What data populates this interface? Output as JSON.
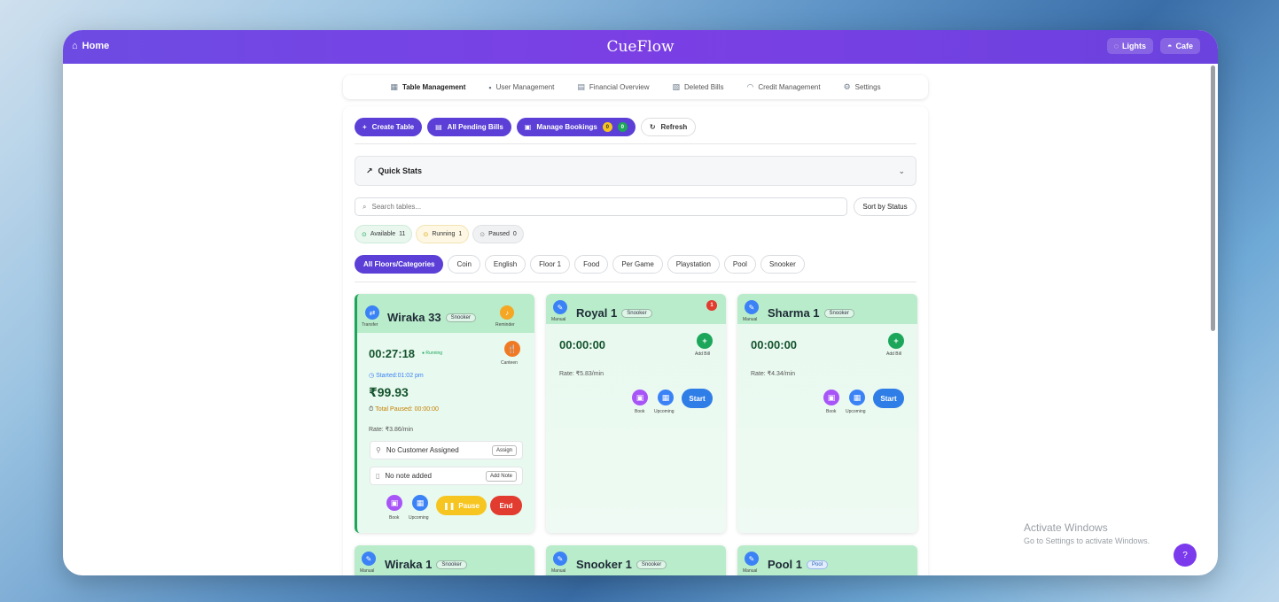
{
  "topbar": {
    "home_label": "Home",
    "brand": "CueFlow",
    "lights_label": "Lights",
    "cafe_label": "Cafe"
  },
  "tabs": [
    {
      "label": "Table Management",
      "icon": "table-icon"
    },
    {
      "label": "User Management",
      "icon": "users-icon"
    },
    {
      "label": "Financial Overview",
      "icon": "chart-icon"
    },
    {
      "label": "Deleted Bills",
      "icon": "bill-icon"
    },
    {
      "label": "Credit Management",
      "icon": "gauge-icon"
    },
    {
      "label": "Settings",
      "icon": "gear-icon"
    }
  ],
  "actions": {
    "create_table": "Create Table",
    "pending_bills": "All Pending Bills",
    "manage_bookings": "Manage Bookings",
    "bookings_badge_1": "0",
    "bookings_badge_2": "0",
    "refresh": "Refresh"
  },
  "quick_stats": {
    "label": "Quick Stats"
  },
  "search": {
    "placeholder": "Search tables...",
    "sort_label": "Sort by Status"
  },
  "status_filters": [
    {
      "label": "Available",
      "count": "11"
    },
    {
      "label": "Running",
      "count": "1"
    },
    {
      "label": "Paused",
      "count": "0"
    }
  ],
  "categories": [
    "All Floors/Categories",
    "Coin",
    "English",
    "Floor 1",
    "Food",
    "Per Game",
    "Playstation",
    "Pool",
    "Snooker"
  ],
  "cards": {
    "running": {
      "name": "Wiraka 33",
      "category": "Snooker",
      "transfer_label": "Transfer",
      "reminder_label": "Reminder",
      "timer": "00:27:18",
      "state": "Running",
      "canteen_label": "Canteen",
      "started": "Started:01:02 pm",
      "amount": "₹99.93",
      "paused": "Total Paused: 00:00:00",
      "rate": "Rate: ₹3.86/min",
      "customer": "No Customer Assigned",
      "assign": "Assign",
      "note": "No note added",
      "add_note": "Add Note",
      "book": "Book",
      "upcoming": "Upcoming",
      "pause": "Pause",
      "end": "End"
    },
    "royal": {
      "name": "Royal 1",
      "category": "Snooker",
      "mode": "Manual",
      "notif": "1",
      "timer": "00:00:00",
      "add_bill": "Add Bill",
      "rate": "Rate: ₹5.83/min",
      "book": "Book",
      "upcoming": "Upcoming",
      "start": "Start"
    },
    "sharma": {
      "name": "Sharma 1",
      "category": "Snooker",
      "mode": "Manual",
      "timer": "00:00:00",
      "add_bill": "Add Bill",
      "rate": "Rate: ₹4.34/min",
      "book": "Book",
      "upcoming": "Upcoming",
      "start": "Start"
    },
    "row2": [
      {
        "name": "Wiraka 1",
        "category": "Snooker",
        "mode": "Manual"
      },
      {
        "name": "Snooker 1",
        "category": "Snooker",
        "mode": "Manual"
      },
      {
        "name": "Pool 1",
        "category": "Pool",
        "mode": "Manual"
      }
    ]
  },
  "watermark": {
    "line1": "Activate Windows",
    "line2": "Go to Settings to activate Windows."
  }
}
